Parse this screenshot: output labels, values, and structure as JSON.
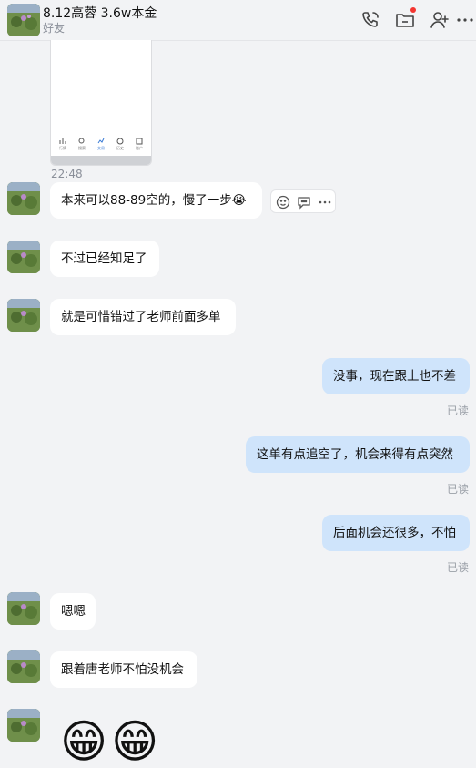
{
  "header": {
    "title": "8.12高蓉 3.6w本金",
    "subtitle": "好友",
    "icons": [
      "phone-call-icon",
      "folder-icon",
      "add-friend-icon",
      "more-icon"
    ]
  },
  "screenshot_preview": {
    "nav_labels": [
      "行情",
      "搜索",
      "交易",
      "历史",
      "账户"
    ]
  },
  "timestamp": "22:48",
  "messages": [
    {
      "side": "left",
      "text": "本来可以88-89空的，慢了一步",
      "emoji": "😭"
    },
    {
      "side": "left",
      "text": "不过已经知足了"
    },
    {
      "side": "left",
      "text": "就是可惜错过了老师前面多单"
    },
    {
      "side": "right",
      "text": "没事，现在跟上也不差",
      "status": "已读"
    },
    {
      "side": "right",
      "text": "这单有点追空了，机会来得有点突然",
      "status": "已读"
    },
    {
      "side": "right",
      "text": "后面机会还很多，不怕",
      "status": "已读"
    },
    {
      "side": "left",
      "text": "嗯嗯"
    },
    {
      "side": "left",
      "text": "跟着唐老师不怕没机会"
    },
    {
      "side": "left",
      "emojis": [
        "😁",
        "😁"
      ]
    }
  ],
  "message_tools": [
    "emoji-reaction-icon",
    "reply-icon",
    "more-icon"
  ],
  "colors": {
    "background": "#f2f3f5",
    "incoming_bubble": "#ffffff",
    "outgoing_bubble": "#cfe4fb",
    "notification_dot": "#f43530"
  }
}
